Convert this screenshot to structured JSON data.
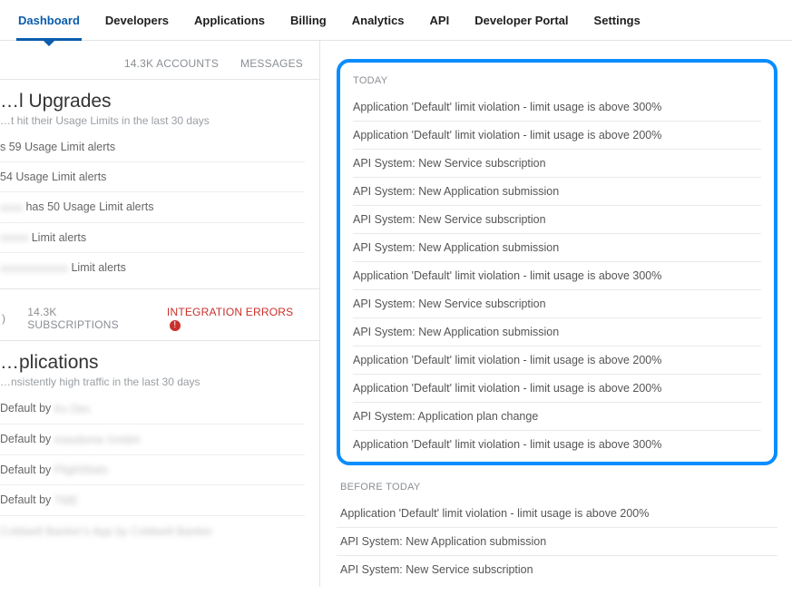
{
  "nav": {
    "items": [
      {
        "label": "Dashboard",
        "active": true
      },
      {
        "label": "Developers"
      },
      {
        "label": "Applications"
      },
      {
        "label": "Billing"
      },
      {
        "label": "Analytics"
      },
      {
        "label": "API"
      },
      {
        "label": "Developer Portal"
      },
      {
        "label": "Settings"
      }
    ]
  },
  "leftTop": {
    "tabs": {
      "accounts": "14.3K ACCOUNTS",
      "messages": "MESSAGES"
    },
    "title": "…l Upgrades",
    "subtitle": "…t hit their Usage Limits in the last 30 days",
    "rows": [
      {
        "prefix": "",
        "blur": "",
        "text": "s 59 Usage Limit alerts"
      },
      {
        "prefix": "",
        "blur": "",
        "text": "54 Usage Limit alerts"
      },
      {
        "prefix": "",
        "blur": "xxxx",
        "text": " has 50 Usage Limit alerts"
      },
      {
        "prefix": "",
        "blur": "xxxxx",
        "text": " Limit alerts"
      },
      {
        "prefix": "",
        "blur": "xxxxxxxxxxxx",
        "text": " Limit alerts"
      }
    ]
  },
  "leftBottom": {
    "tabs": {
      "left": ")",
      "subs": "14.3K SUBSCRIPTIONS",
      "errors": "INTEGRATION ERRORS",
      "errorMark": "!"
    },
    "title": "…plications",
    "subtitle": "…nsistently high traffic in the last 30 days",
    "rows": [
      {
        "text": "Default by ",
        "blur": "Kx Dec"
      },
      {
        "text": "Default by ",
        "blur": "maxdome GmbH"
      },
      {
        "text": "Default by ",
        "blur": "FlightStats"
      },
      {
        "text": "Default by ",
        "blur": "TME"
      },
      {
        "text": "",
        "blur": "Coldwell Banker's App by Coldwell Banker"
      }
    ]
  },
  "messages": {
    "todayLabel": "TODAY",
    "beforeLabel": "BEFORE TODAY",
    "today": [
      "Application 'Default' limit violation - limit usage is above 300%",
      "Application 'Default' limit violation - limit usage is above 200%",
      "API System: New Service subscription",
      "API System: New Application submission",
      "API System: New Service subscription",
      "API System: New Application submission",
      "Application 'Default' limit violation - limit usage is above 300%",
      "API System: New Service subscription",
      "API System: New Application submission",
      "Application 'Default' limit violation - limit usage is above 200%",
      "Application 'Default' limit violation - limit usage is above 200%",
      "API System: Application plan change",
      "Application 'Default' limit violation - limit usage is above 300%"
    ],
    "before": [
      "Application 'Default' limit violation - limit usage is above 200%",
      "API System: New Application submission",
      "API System: New Service subscription"
    ]
  }
}
